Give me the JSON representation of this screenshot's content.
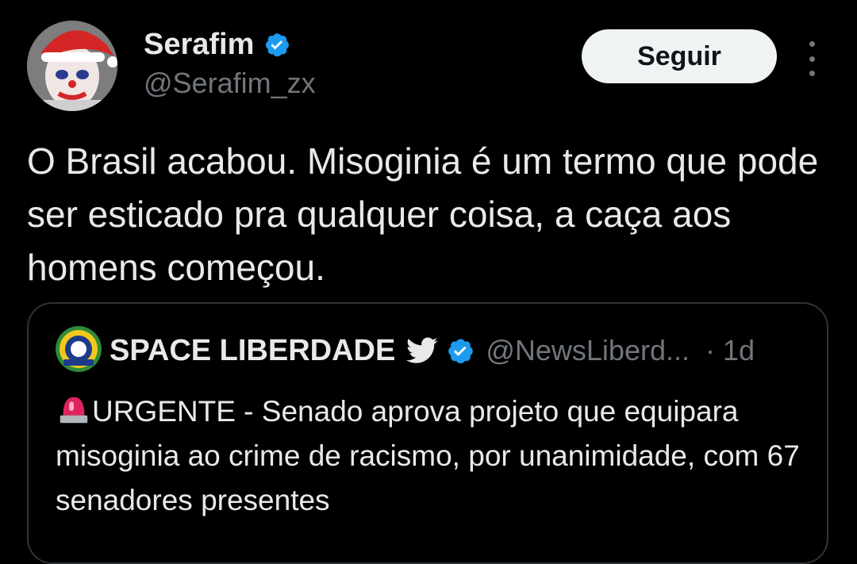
{
  "tweet": {
    "author_name": "Serafim",
    "author_handle": "@Serafim_zx",
    "follow_label": "Seguir",
    "text": "O Brasil acabou. Misoginia é um termo que pode ser esticado pra qualquer coisa, a caça aos homens começou.",
    "verified_color": "#1d9bf0"
  },
  "quote": {
    "author_name": "SPACE LIBERDADE",
    "author_handle": "@NewsLiberd...",
    "time": "· 1d",
    "text": "URGENTE - Senado aprova projeto que equipara misoginia ao crime de racismo, por unanimidade, com 67 senadores presentes",
    "icons": [
      "twitter-bird-icon",
      "verified-icon",
      "siren-icon"
    ]
  }
}
